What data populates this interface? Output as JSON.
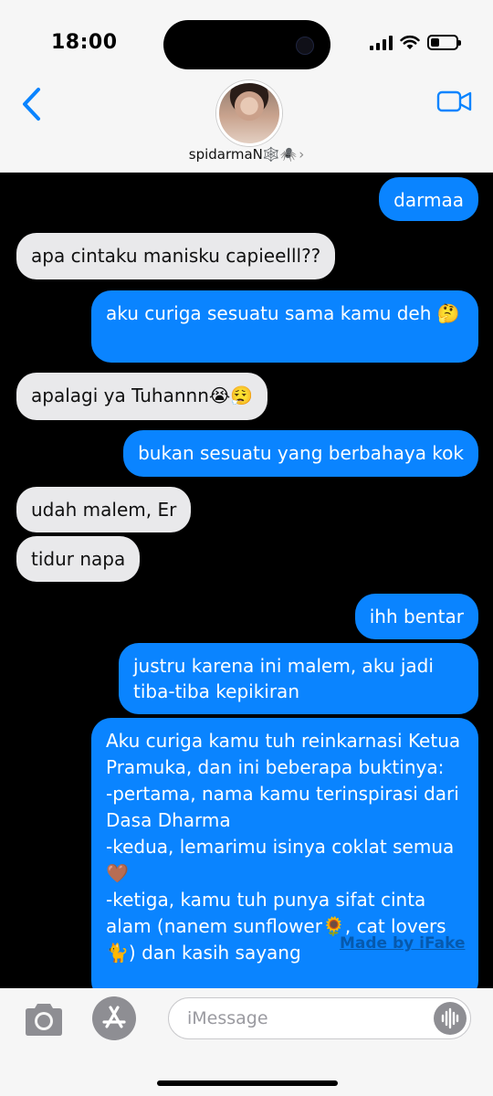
{
  "status_bar": {
    "time": "18:00",
    "battery_level": 0.35
  },
  "header": {
    "contact_name": "spidarmaN🕸️🕷️",
    "chevron": "›",
    "back_icon": "chevron-left-icon",
    "video_icon": "video-camera-icon"
  },
  "messages": [
    {
      "side": "out",
      "text": "darmaa"
    },
    {
      "side": "in",
      "text": "apa cintaku manisku capieelll??"
    },
    {
      "side": "out",
      "text": "aku curiga sesuatu sama kamu deh 🤔"
    },
    {
      "side": "in",
      "text": "apalagi ya Tuhannn😭😮‍💨"
    },
    {
      "side": "out",
      "text": "bukan sesuatu yang berbahaya kok"
    },
    {
      "side": "in",
      "text": "udah malem, Er"
    },
    {
      "side": "in",
      "text": "tidur napa"
    },
    {
      "side": "out",
      "text": "ihh bentar"
    },
    {
      "side": "out",
      "text": "justru karena ini malem, aku jadi tiba-tiba kepikiran"
    },
    {
      "side": "out",
      "text": "Aku curiga kamu tuh reinkarnasi Ketua Pramuka, dan ini beberapa buktinya:\n-pertama, nama kamu terinspirasi dari Dasa Dharma\n-kedua, lemarimu isinya coklat semua🤎\n-ketiga, kamu tuh punya sifat cinta alam (nanem sunflower🌻, cat lovers 🐈) dan kasih sayang"
    }
  ],
  "watermark": "Made by iFake",
  "composer": {
    "placeholder": "iMessage"
  },
  "colors": {
    "outgoing": "#0a84ff",
    "incoming": "#e9e9eb",
    "background": "#000000",
    "bars": "#f6f6f6"
  }
}
